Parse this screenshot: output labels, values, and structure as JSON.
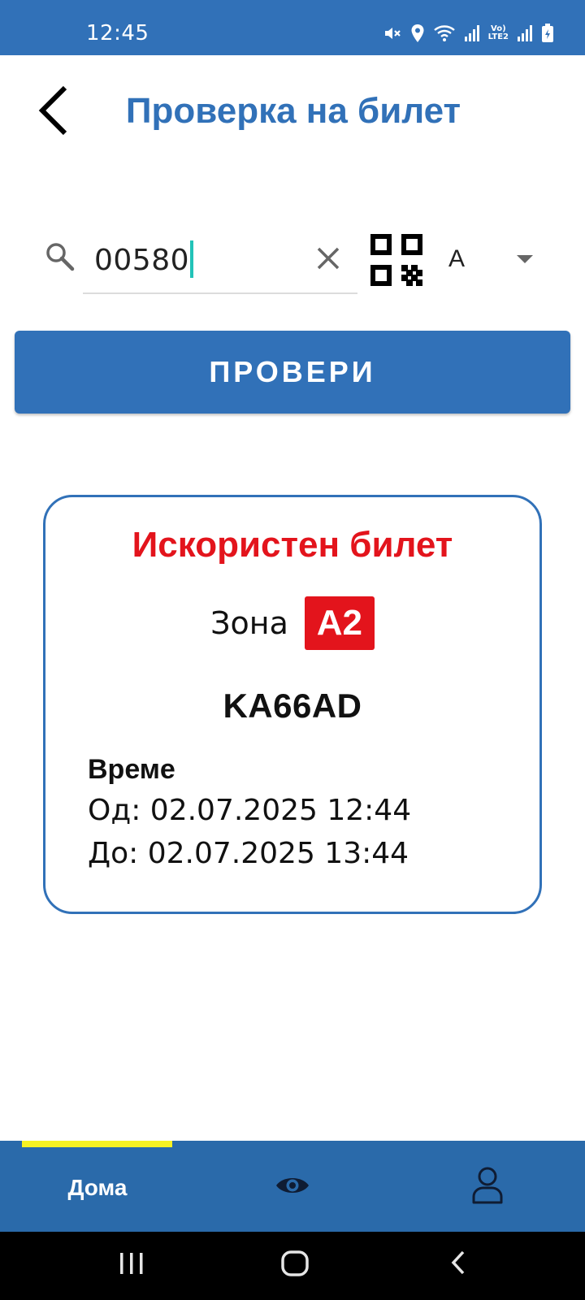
{
  "status_bar": {
    "time": "12:45",
    "icons": [
      "mute-icon",
      "location-icon",
      "wifi-icon",
      "signal-icon",
      "volte-icon",
      "signal-icon",
      "battery-icon"
    ],
    "volte_top": "Vo)",
    "volte_bottom": "LTE2"
  },
  "header": {
    "title": "Проверка на билет",
    "back_icon": "chevron-left-icon"
  },
  "search": {
    "value": "00580",
    "clear_icon": "close-icon",
    "qr_icon": "qr-code-icon",
    "zone_selected": "A"
  },
  "check_button": {
    "label": "ПРОВЕРИ"
  },
  "result": {
    "status": "Искористен билет",
    "zone_label": "Зона",
    "zone_code": "A2",
    "plate": "KA66AD",
    "time_title": "Време",
    "from": "Од: 02.07.2025 12:44",
    "to": "До: 02.07.2025 13:44"
  },
  "bottom_nav": {
    "home_label": "Дома",
    "items": [
      "home",
      "eye-icon",
      "user-icon"
    ]
  },
  "system_nav": [
    "recent-apps-icon",
    "home-circle-icon",
    "back-icon"
  ],
  "colors": {
    "primary": "#3171b8",
    "nav_background": "#2a6aaa",
    "alert_red": "#e3141c",
    "indicator_yellow": "#f6f222",
    "caret": "#22c3b8"
  }
}
